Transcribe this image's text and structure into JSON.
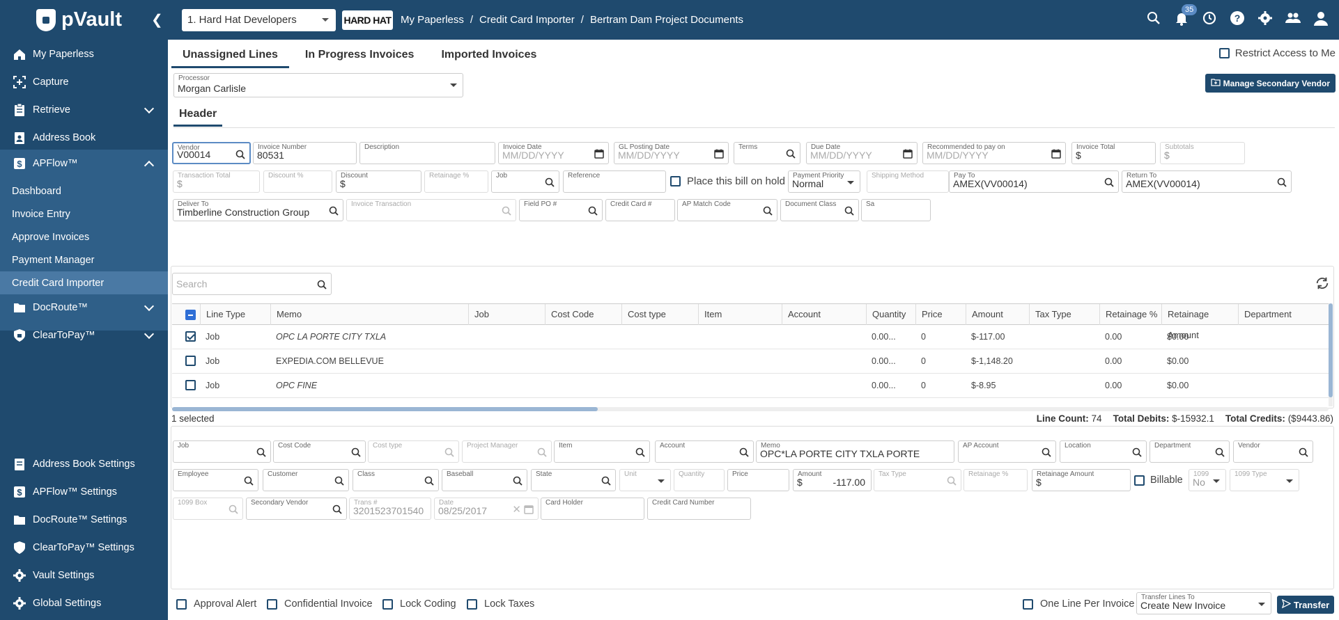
{
  "app": {
    "name": "pVault"
  },
  "company_select": {
    "value": "1. Hard Hat Developers"
  },
  "company_logo": {
    "text": "HARD HAT"
  },
  "breadcrumb": [
    "My Paperless",
    "/",
    "Credit Card Importer",
    "/",
    "Bertram Dam Project Documents"
  ],
  "notifications": {
    "count": "35"
  },
  "sidebar": {
    "items": [
      {
        "label": "My Paperless"
      },
      {
        "label": "Capture"
      },
      {
        "label": "Retrieve"
      },
      {
        "label": "Address Book"
      },
      {
        "label": "APFlow™"
      },
      {
        "label": "DocRoute™"
      },
      {
        "label": "ClearToPay™"
      }
    ],
    "apflow_sub": [
      {
        "label": "Dashboard"
      },
      {
        "label": "Invoice Entry"
      },
      {
        "label": "Approve Invoices"
      },
      {
        "label": "Payment Manager"
      },
      {
        "label": "Credit Card Importer"
      }
    ],
    "settings": [
      {
        "label": "Address Book Settings"
      },
      {
        "label": "APFlow™ Settings"
      },
      {
        "label": "DocRoute™ Settings"
      },
      {
        "label": "ClearToPay™ Settings"
      },
      {
        "label": "Vault Settings"
      },
      {
        "label": "Global Settings"
      }
    ]
  },
  "tabs": [
    {
      "label": "Unassigned Lines"
    },
    {
      "label": "In Progress Invoices"
    },
    {
      "label": "Imported Invoices"
    }
  ],
  "restrict_access": {
    "label": "Restrict Access to Me",
    "checked": false
  },
  "processor": {
    "label": "Processor",
    "value": "Morgan Carlisle"
  },
  "manage_secondary_vendor": {
    "label": "Manage Secondary Vendor"
  },
  "header_tab": {
    "label": "Header"
  },
  "header_fields": {
    "vendor": {
      "label": "Vendor",
      "value": "V00014"
    },
    "invoice_number": {
      "label": "Invoice Number",
      "value": "80531"
    },
    "description": {
      "label": "Description",
      "value": ""
    },
    "invoice_date": {
      "label": "Invoice Date",
      "placeholder": "MM/DD/YYYY"
    },
    "gl_posting_date": {
      "label": "GL Posting Date",
      "placeholder": "MM/DD/YYYY"
    },
    "terms": {
      "label": "Terms",
      "value": ""
    },
    "due_date": {
      "label": "Due Date",
      "placeholder": "MM/DD/YYYY"
    },
    "recommended_to_pay_on": {
      "label": "Recommended to pay on",
      "placeholder": "MM/DD/YYYY"
    },
    "invoice_total": {
      "label": "Invoice Total",
      "value": "$"
    },
    "subtotals": {
      "label": "Subtotals",
      "value": "$"
    },
    "transaction_total": {
      "label": "Transaction Total",
      "value": "$"
    },
    "discount_pct": {
      "label": "Discount %",
      "value": ""
    },
    "discount": {
      "label": "Discount",
      "value": "$"
    },
    "retainage_pct": {
      "label": "Retainage %",
      "value": ""
    },
    "job": {
      "label": "Job",
      "value": ""
    },
    "reference": {
      "label": "Reference",
      "value": ""
    },
    "place_on_hold": {
      "label": "Place this bill on hold",
      "checked": false
    },
    "payment_priority": {
      "label": "Payment Priority",
      "value": "Normal"
    },
    "shipping_method": {
      "label": "Shipping Method",
      "value": ""
    },
    "pay_to": {
      "label": "Pay To",
      "value": "AMEX(VV00014)"
    },
    "return_to": {
      "label": "Return To",
      "value": "AMEX(VV00014)"
    },
    "deliver_to": {
      "label": "Deliver To",
      "value": "Timberline Construction Group"
    },
    "invoice_transaction": {
      "label": "Invoice Transaction",
      "value": ""
    },
    "field_po": {
      "label": "Field PO #",
      "value": ""
    },
    "credit_card": {
      "label": "Credit Card #",
      "value": ""
    },
    "ap_match_code": {
      "label": "AP Match Code",
      "value": ""
    },
    "document_class": {
      "label": "Document Class",
      "value": ""
    },
    "sa": {
      "label": "Sa",
      "value": ""
    }
  },
  "grid": {
    "search_placeholder": "Search",
    "columns": [
      "Line Type",
      "Memo",
      "Job",
      "Cost Code",
      "Cost type",
      "Item",
      "Account",
      "Quantity",
      "Price",
      "Amount",
      "Tax Type",
      "Retainage %",
      "Retainage Amount",
      "Department"
    ],
    "rows": [
      {
        "checked": true,
        "line_type": "Job",
        "memo": "OPC LA PORTE CITY TXLA",
        "memo_italic": true,
        "quantity": "0.00...",
        "price": "0",
        "amount": "$-117.00",
        "retainage_pct": "0.00",
        "retainage_amount": "$0.00"
      },
      {
        "checked": false,
        "line_type": "Job",
        "memo": "EXPEDIA.COM BELLEVUE",
        "memo_italic": false,
        "quantity": "0.00...",
        "price": "0",
        "amount": "$-1,148.20",
        "retainage_pct": "0.00",
        "retainage_amount": "$0.00"
      },
      {
        "checked": false,
        "line_type": "Job",
        "memo": "OPC FINE",
        "memo_italic": true,
        "quantity": "0.00...",
        "price": "0",
        "amount": "$-8.95",
        "retainage_pct": "0.00",
        "retainage_amount": "$0.00"
      }
    ],
    "selected_text": "1 selected",
    "line_count_label": "Line Count:",
    "line_count": "74",
    "total_debits_label": "Total Debits:",
    "total_debits": "$-15932.1",
    "total_credits_label": "Total Credits:",
    "total_credits": "($9443.86)"
  },
  "line_fields": {
    "job": {
      "label": "Job",
      "value": ""
    },
    "cost_code": {
      "label": "Cost Code",
      "value": ""
    },
    "cost_type": {
      "label": "Cost type",
      "value": ""
    },
    "project_manager": {
      "label": "Project Manager",
      "value": ""
    },
    "item": {
      "label": "Item",
      "value": ""
    },
    "account": {
      "label": "Account",
      "value": ""
    },
    "memo": {
      "label": "Memo",
      "value": "OPC*LA PORTE CITY TXLA PORTE"
    },
    "ap_account": {
      "label": "AP Account",
      "value": ""
    },
    "location": {
      "label": "Location",
      "value": ""
    },
    "department": {
      "label": "Department",
      "value": ""
    },
    "vendor": {
      "label": "Vendor",
      "value": ""
    },
    "employee": {
      "label": "Employee",
      "value": ""
    },
    "customer": {
      "label": "Customer",
      "value": ""
    },
    "class": {
      "label": "Class",
      "value": ""
    },
    "baseball": {
      "label": "Baseball",
      "value": ""
    },
    "state": {
      "label": "State",
      "value": ""
    },
    "unit": {
      "label": "Unit",
      "value": ""
    },
    "quantity": {
      "label": "Quantity",
      "value": ""
    },
    "price": {
      "label": "Price",
      "value": ""
    },
    "amount": {
      "label": "Amount",
      "prefix": "$",
      "value": "-117.00"
    },
    "tax_type": {
      "label": "Tax Type",
      "value": ""
    },
    "retainage_pct": {
      "label": "Retainage %",
      "value": ""
    },
    "retainage_amount": {
      "label": "Retainage Amount",
      "value": "$"
    },
    "billable": {
      "label": "Billable",
      "checked": false
    },
    "f1099": {
      "label": "1099",
      "value": "No"
    },
    "f1099_type": {
      "label": "1099 Type",
      "value": ""
    },
    "f1099_box": {
      "label": "1099 Box",
      "value": ""
    },
    "secondary_vendor": {
      "label": "Secondary Vendor",
      "value": ""
    },
    "trans_no": {
      "label": "Trans #",
      "value": "3201523701540"
    },
    "date": {
      "label": "Date",
      "value": "08/25/2017"
    },
    "card_holder": {
      "label": "Card Holder",
      "value": ""
    },
    "credit_card_number": {
      "label": "Credit Card Number",
      "value": ""
    }
  },
  "bottom": {
    "approval_alert": "Approval Alert",
    "confidential_invoice": "Confidential Invoice",
    "lock_coding": "Lock Coding",
    "lock_taxes": "Lock Taxes",
    "one_line_per_invoice": "One Line Per Invoice",
    "transfer_lines_to": {
      "label": "Transfer Lines To",
      "value": "Create New Invoice"
    },
    "transfer": "Transfer"
  },
  "colors": {
    "brand": "#1f4a6e",
    "sidebar_sub": "#2f5f88",
    "selected": "#4a79a4",
    "accent": "#2f6fd6"
  }
}
